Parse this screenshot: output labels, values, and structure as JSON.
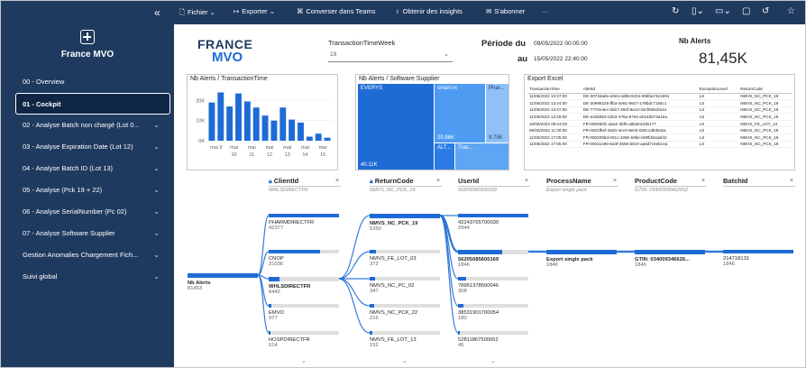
{
  "sidebar": {
    "workspace_name": "France MVO",
    "items": [
      {
        "label": "00 - Overview",
        "chevron": false,
        "active": false
      },
      {
        "label": "01 - Cockpit",
        "chevron": false,
        "active": true
      },
      {
        "label": "02 - Analyse Batch non chargé (Lot 0...",
        "chevron": true,
        "active": false
      },
      {
        "label": "03 - Analyse Expiration Date (Lot 12)",
        "chevron": true,
        "active": false
      },
      {
        "label": "04 - Analyse Batch ID (Lot 13)",
        "chevron": true,
        "active": false
      },
      {
        "label": "05 - Analyse (Pck 19 + 22)",
        "chevron": true,
        "active": false
      },
      {
        "label": "06 - Analyse SerialNumber (Pc 02)",
        "chevron": true,
        "active": false
      },
      {
        "label": "07 - Analyse Software Supplier",
        "chevron": true,
        "active": false
      },
      {
        "label": "Gestion Anomalies Chargement Fich...",
        "chevron": true,
        "active": false
      },
      {
        "label": "Suivi global",
        "chevron": true,
        "active": false
      }
    ]
  },
  "toolbar": {
    "collapse_glyph": "«",
    "file": "Fichier",
    "export": "Exporter",
    "teams": "Converser dans Teams",
    "insights": "Obtenir des insights",
    "subscribe": "S'abonner",
    "more": "···"
  },
  "filters": {
    "ttw_label": "TransactionTimeWeek",
    "ttw_value": "19",
    "period_from_label": "Période du",
    "period_from_value": "09/05/2022 00:05:00",
    "period_to_label": "au",
    "period_to_value": "15/05/2022 22:40:00"
  },
  "logo": {
    "line1": "FRANCE",
    "line2": "MVO"
  },
  "kpi": {
    "title": "Nb Alerts",
    "value": "81,45K"
  },
  "bar_visual": {
    "title": "Nb Alerts / TransactionTime",
    "y_ticks": [
      "20K",
      "10K",
      "0K"
    ],
    "x_ticks_top": [
      "mai 9",
      "mai",
      "mai",
      "mai",
      "mai",
      "mai",
      "mai"
    ],
    "x_ticks_bot": [
      "",
      "10",
      "11",
      "12",
      "13",
      "14",
      "15"
    ]
  },
  "chart_data": {
    "type": "bar",
    "title": "Nb Alerts / TransactionTime",
    "ylim": [
      0,
      26000
    ],
    "values": [
      19000,
      24000,
      17000,
      23500,
      19500,
      16500,
      12500,
      10000,
      16500,
      10500,
      9000,
      2000,
      3500,
      1500
    ]
  },
  "treemap": {
    "title": "Nb Alerts / Software Supplier",
    "tiles": [
      {
        "label": "EVERYS",
        "value": "40.11K",
        "color": "#1f6bd6"
      },
      {
        "label": "smart-rx",
        "value": "20.96K",
        "color": "#4f9bf1"
      },
      {
        "label": "Phar...",
        "value": "9.75K",
        "color": "#8fc1f7"
      },
      {
        "label": "ALT...",
        "value": "",
        "color": "#2c7be5"
      },
      {
        "label": "Trac...",
        "value": "",
        "color": "#5ea6f3"
      }
    ]
  },
  "export_table": {
    "title": "Export Excel",
    "columns": [
      "TransactionTime",
      "AlertId",
      "ExceptionLevel",
      "ReturnCode"
    ],
    "rows": [
      [
        "11/05/2022 13:47:00",
        "DE-0072da8e-e824-4d86-8c04-69bba74e1691",
        "LS",
        "NMVS_NC_PCK_19"
      ],
      [
        "11/05/2022 13:44:00",
        "DE-30995226-ffb3-4e81-9917-178bdc7155c1",
        "LS",
        "NMVS_NC_PCK_19"
      ],
      [
        "11/05/2022 13:47:00",
        "DE-7770e4ec-bbb7-464f-8a13-33cf608cbe44",
        "LS",
        "NMVS_NC_PCK_19"
      ],
      [
        "11/05/2022 13:49:00",
        "DE-e42b8b2-22b3-475a-87e0-a014bb74a16a",
        "LS",
        "NMVS_NC_PCK_19"
      ],
      [
        "10/05/2022 09:24:00",
        "FR-0000defc-a5a2-4bf6-a8beb4335177",
        "LS",
        "NMVS_FE_LOT_13"
      ],
      [
        "09/05/2022 11:30:00",
        "FR-0001fbef-25d4-4ec0-9e03-025c1d8354ac",
        "LS",
        "NMVS_NC_PCK_19"
      ],
      [
        "11/05/2022 17:05:00",
        "FR-000209bd-061c-428b-b8be-b09fd3edaf42",
        "LS",
        "NMVS_NC_PCK_19"
      ],
      [
        "11/05/2022 17:05:00",
        "FR-00021496-5d4f-4556-b6c0-aa6d7c5ebc4a",
        "LS",
        "NMVS_NC_PCK_19"
      ]
    ]
  },
  "decomp": {
    "root": {
      "label": "Nb Alerts",
      "value": "81453"
    },
    "columns": [
      {
        "header": "ClientId",
        "sub": "WHLSDIRECTFR",
        "locked": true
      },
      {
        "header": "ReturnCode",
        "sub": "NMVS_NC_PCK_19",
        "locked": true
      },
      {
        "header": "UserId",
        "sub": "56205085600169",
        "locked": false
      },
      {
        "header": "ProcessName",
        "sub": "Export single pack",
        "locked": false
      },
      {
        "header": "ProductCode",
        "sub": "GTIN: 03400939462652",
        "locked": false
      },
      {
        "header": "BatchId",
        "sub": "",
        "locked": false
      }
    ],
    "client_nodes": [
      {
        "label": "PHARMDIRECTFR",
        "value": "42377",
        "pct": 1.0
      },
      {
        "label": "CNOP",
        "value": "31036",
        "pct": 0.73
      },
      {
        "label": "WHLSDIRECTFR",
        "value": "6442",
        "pct": 0.16
      },
      {
        "label": "EMVO",
        "value": "977",
        "pct": 0.04
      },
      {
        "label": "HOSPDIRECTFR",
        "value": "614",
        "pct": 0.03
      }
    ],
    "return_nodes": [
      {
        "label": "NMVS_NC_PCK_19",
        "value": "5350",
        "pct": 1.0
      },
      {
        "label": "NMVS_FE_LOT_03",
        "value": "372",
        "pct": 0.09
      },
      {
        "label": "NMVS_NC_PC_02",
        "value": "347",
        "pct": 0.08
      },
      {
        "label": "NMVS_NC_PCK_22",
        "value": "216",
        "pct": 0.06
      },
      {
        "label": "NMVS_FE_LOT_13",
        "value": "152",
        "pct": 0.04
      }
    ],
    "user_nodes": [
      {
        "label": "42243765700030",
        "value": "2944",
        "pct": 1.0
      },
      {
        "label": "56205085600169",
        "value": "1846",
        "pct": 0.63
      },
      {
        "label": "78951378500046",
        "value": "308",
        "pct": 0.12
      },
      {
        "label": "38531901700054",
        "value": "180",
        "pct": 0.08
      },
      {
        "label": "52811867500062",
        "value": "45",
        "pct": 0.03
      }
    ],
    "process_node": {
      "label": "Export single pack",
      "value": "1846"
    },
    "product_node": {
      "label": "GTIN: 034009346626...",
      "value": "1846"
    },
    "batch_node": {
      "label": "214718131",
      "value": "1846"
    }
  }
}
